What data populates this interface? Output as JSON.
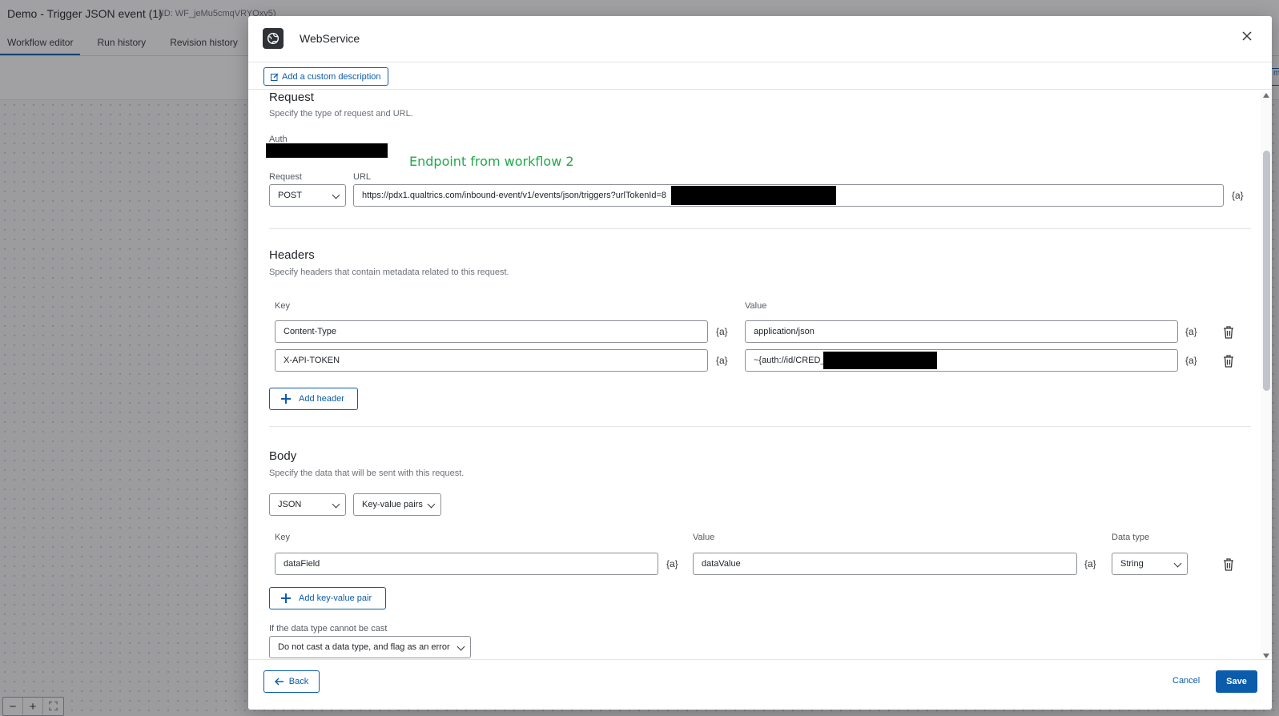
{
  "app": {
    "title": "Demo - Trigger JSON event (1)",
    "id_label": "(ID: WF_jeMu5cmqVRYOxv5)",
    "tabs": [
      "Workflow editor",
      "Run history",
      "Revision history"
    ],
    "edge_button_text": "m"
  },
  "zoom": {
    "out": "−",
    "in": "+",
    "fit": "⛶"
  },
  "modal": {
    "title": "WebService",
    "custom_description": "Add a custom description",
    "request": {
      "title": "Request",
      "description": "Specify the type of request and URL.",
      "auth_label": "Auth",
      "annotation": "Endpoint from workflow 2",
      "method_label": "Request",
      "method": "POST",
      "url_label": "URL",
      "url": "https://pdx1.qualtrics.com/inbound-event/v1/events/json/triggers?urlTokenId=8",
      "piped_text": "{a}"
    },
    "headers": {
      "title": "Headers",
      "description": "Specify headers that contain metadata related to this request.",
      "key_label": "Key",
      "value_label": "Value",
      "rows": [
        {
          "key": "Content-Type",
          "value": "application/json"
        },
        {
          "key": "X-API-TOKEN",
          "value": "~{auth://id/CRED_"
        }
      ],
      "add_label": "Add header"
    },
    "body": {
      "title": "Body",
      "description": "Specify the data that will be sent with this request.",
      "format": "JSON",
      "mode": "Key-value pairs",
      "key_label": "Key",
      "value_label": "Value",
      "type_label": "Data type",
      "rows": [
        {
          "key": "dataField",
          "value": "dataValue",
          "type": "String"
        }
      ],
      "add_label": "Add key-value pair",
      "cast_label": "If the data type cannot be cast",
      "cast_value": "Do not cast a data type, and flag as an error"
    },
    "footer": {
      "back": "Back",
      "cancel": "Cancel",
      "save": "Save"
    }
  },
  "colors": {
    "accent": "#0b5cab",
    "annotation": "#22a84a",
    "redaction": "#000000"
  }
}
